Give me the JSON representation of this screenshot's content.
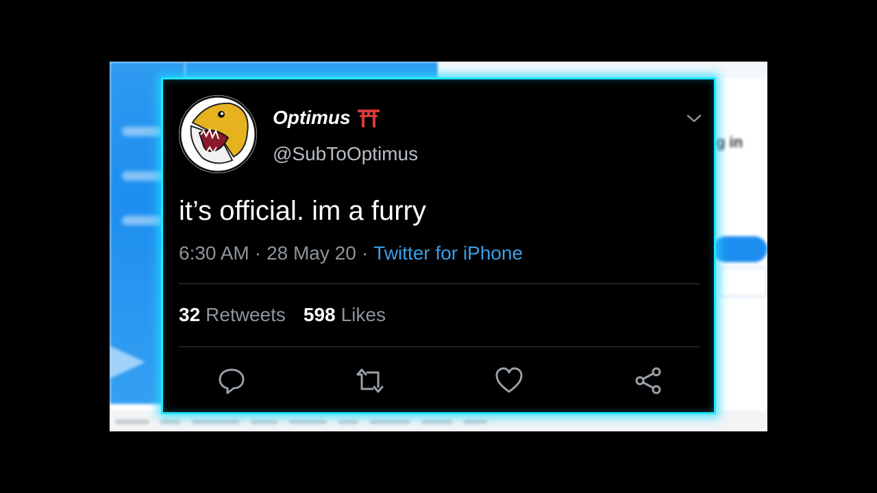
{
  "background_page": {
    "login_text": "g in"
  },
  "tweet": {
    "display_name": "Optimus",
    "name_emoji_icon": "torii-gate-icon",
    "handle": "@SubToOptimus",
    "text": "it’s official. im a furry",
    "time": "6:30 AM",
    "date": "28 May 20",
    "separator": "·",
    "source": "Twitter for iPhone",
    "retweets_count": "32",
    "retweets_label": "Retweets",
    "likes_count": "598",
    "likes_label": "Likes"
  },
  "icons": {
    "menu": "chevron-down-icon",
    "reply": "reply-icon",
    "retweet": "retweet-icon",
    "like": "heart-icon",
    "share": "share-icon"
  },
  "colors": {
    "card_glow": "#22e6ff",
    "card_background": "#000000",
    "link_blue": "#3a9fe8",
    "muted_text": "#8e959c",
    "torii_red": "#d83a3a"
  }
}
